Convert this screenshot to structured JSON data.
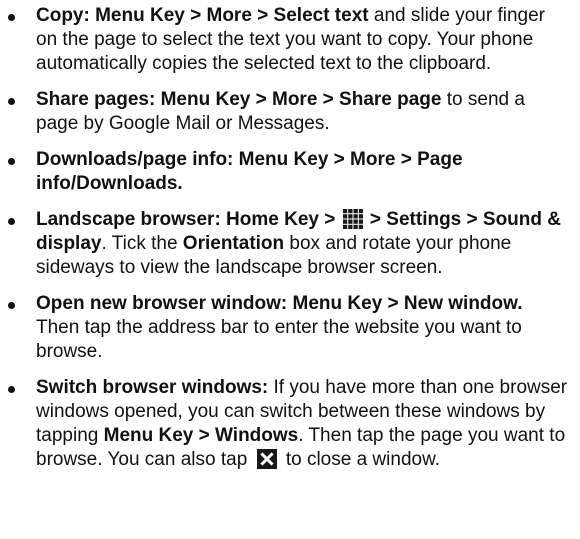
{
  "items": [
    {
      "b1": "Copy: Menu Key > More > Select text",
      "t1": " and slide your finger on the page to select the text you want to copy. Your phone automatically copies the selected text to the clipboard."
    },
    {
      "b1": "Share pages: Menu Key > More > Share page",
      "t1": " to send a page by Google Mail or Messages."
    },
    {
      "b1": "Downloads/page info: Menu Key > More > Page info/Downloads."
    },
    {
      "b1": "Landscape browser: Home Key > ",
      "icon": "app-grid-icon",
      "b2": " > Settings > Sound & display",
      "t1": ". Tick the ",
      "b3": "Orientation",
      "t2": " box and rotate your phone sideways to view the landscape browser screen."
    },
    {
      "b1": "Open new browser window: Menu Key > New window.",
      "t1": " Then tap the address bar to enter the website you want to browse."
    },
    {
      "b1": "Switch browser windows:",
      "t1": " If you have more than one browser windows opened, you can switch between these windows by tapping ",
      "b2": "Menu Key > Windows",
      "t2": ". Then tap the page you want to browse. You can also tap ",
      "icon": "close-icon",
      "t3": " to close a window."
    }
  ],
  "colors": {
    "text": "#111111",
    "icon_fill": "#1a1a1a",
    "icon_mark": "#ffffff"
  }
}
